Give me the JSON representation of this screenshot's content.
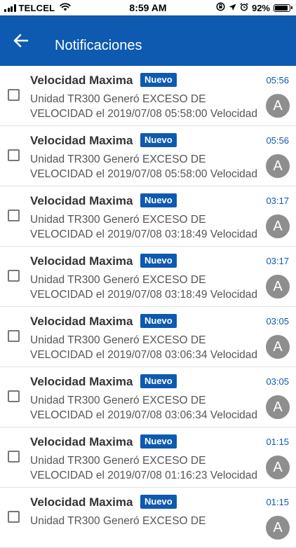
{
  "status_bar": {
    "carrier": "TELCEL",
    "time": "8:59 AM",
    "battery": "92%",
    "battery_level": 0.92
  },
  "header": {
    "title": "Notificaciones",
    "back_icon": "arrow-left-icon"
  },
  "colors": {
    "primary": "#0d5ab0",
    "avatar": "#8e8e8e"
  },
  "notifications": [
    {
      "title": "Velocidad Maxima",
      "badge": "Nuevo",
      "time": "05:56",
      "line1": "Unidad TR300 Generó EXCESO DE",
      "line2": "VELOCIDAD el 2019/07/08 05:58:00 Velocidad",
      "avatar": "A"
    },
    {
      "title": "Velocidad Maxima",
      "badge": "Nuevo",
      "time": "05:56",
      "line1": "Unidad TR300 Generó EXCESO DE",
      "line2": "VELOCIDAD el 2019/07/08 05:58:00 Velocidad",
      "avatar": "A"
    },
    {
      "title": "Velocidad Maxima",
      "badge": "Nuevo",
      "time": "03:17",
      "line1": "Unidad TR300 Generó EXCESO DE",
      "line2": "VELOCIDAD el 2019/07/08 03:18:49 Velocidad",
      "avatar": "A"
    },
    {
      "title": "Velocidad Maxima",
      "badge": "Nuevo",
      "time": "03:17",
      "line1": "Unidad TR300 Generó EXCESO DE",
      "line2": "VELOCIDAD el 2019/07/08 03:18:49 Velocidad",
      "avatar": "A"
    },
    {
      "title": "Velocidad Maxima",
      "badge": "Nuevo",
      "time": "03:05",
      "line1": "Unidad TR300 Generó EXCESO DE",
      "line2": "VELOCIDAD el 2019/07/08 03:06:34 Velocidad",
      "avatar": "A"
    },
    {
      "title": "Velocidad Maxima",
      "badge": "Nuevo",
      "time": "03:05",
      "line1": "Unidad TR300 Generó EXCESO DE",
      "line2": "VELOCIDAD el 2019/07/08 03:06:34 Velocidad",
      "avatar": "A"
    },
    {
      "title": "Velocidad Maxima",
      "badge": "Nuevo",
      "time": "01:15",
      "line1": "Unidad TR300 Generó EXCESO DE",
      "line2": "VELOCIDAD el 2019/07/08 01:16:23 Velocidad",
      "avatar": "A"
    },
    {
      "title": "Velocidad Maxima",
      "badge": "Nuevo",
      "time": "01:15",
      "line1": "Unidad TR300 Generó EXCESO DE",
      "line2": "",
      "avatar": "A"
    }
  ]
}
